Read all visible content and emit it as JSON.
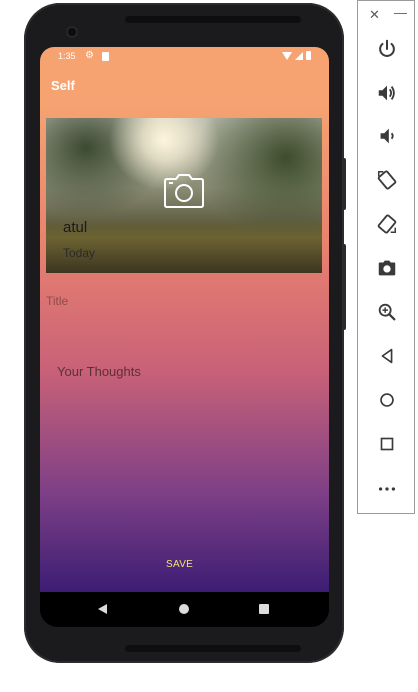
{
  "status_bar": {
    "time": "1:35"
  },
  "app_bar": {
    "title": "Self"
  },
  "hero": {
    "name": "atul",
    "date": "Today"
  },
  "form": {
    "title_placeholder": "Title",
    "thoughts_placeholder": "Your Thoughts",
    "save_label": "SAVE"
  },
  "emulator": {
    "close_label": "✕",
    "minimize_label": "—"
  },
  "colors": {
    "app_bar": "#f6a371",
    "gradient_top": "#f6a371",
    "gradient_bottom": "#3c1d74",
    "save_text": "#f5e56b"
  }
}
